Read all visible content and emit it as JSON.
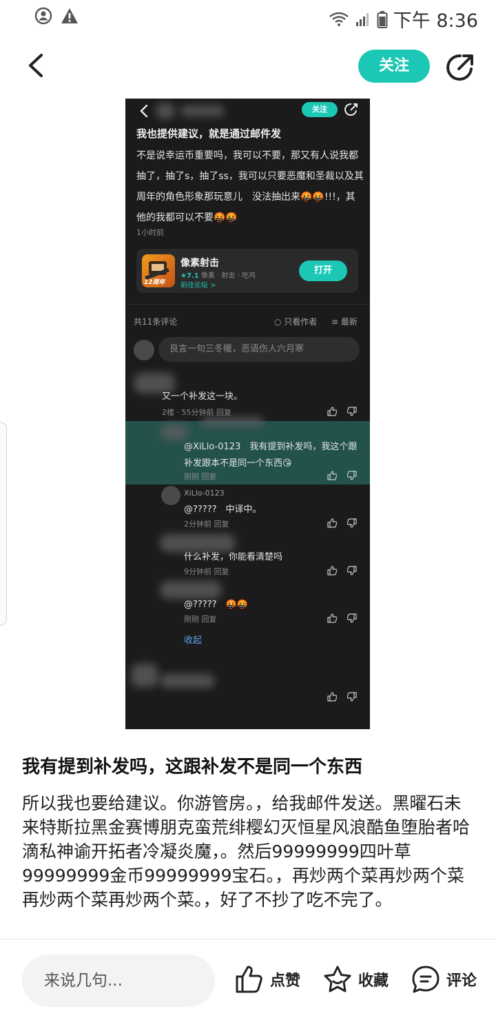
{
  "status_bar": {
    "time": "下午 8:36",
    "icons": [
      "account-circle-icon",
      "warning-icon",
      "wifi-icon",
      "signal-icon",
      "battery-icon"
    ]
  },
  "header": {
    "follow_label": "关注",
    "icons": [
      "back-arrow-icon",
      "share-icon"
    ]
  },
  "screenshot": {
    "follow_label": "关注",
    "title": "我也提供建议，就是通过邮件发",
    "body": "不是说幸运币重要吗，我可以不要，那又有人说我都抽了，抽了s，抽了ss，我可以只要恶魔和圣裁以及其周年的角色形象那玩意儿　没法抽出来🤬🤬!!!，其他的我都可以不要🤬🤬",
    "time": "1小时前",
    "game": {
      "name": "像素射击",
      "score": "★7.1",
      "tags": "像素 · 射击 · 吃鸡",
      "link": "前往论坛 >",
      "open_label": "打开",
      "badge": "12周年"
    },
    "comments_count": "共11条评论",
    "filter_author": "只看作者",
    "filter_latest": "最新",
    "input_placeholder": "良言一句三冬暖，恶语伤人六月寒",
    "comments": [
      {
        "text": "又一个补发这一块。",
        "meta": "2楼 · 55分钟前  回复"
      },
      {
        "text": "@XiLlo-0123　我有提到补发吗，我这个跟补发跟本不是同一个东西😘",
        "meta": "刚刚  回复"
      },
      {
        "name": "XiLlo-0123",
        "text": "@?????　中译中。",
        "meta": "2分钟前  回复"
      },
      {
        "text": "什么补发，你能看清楚吗",
        "meta": "9分钟前  回复"
      },
      {
        "text": "@?????　🤬🤬",
        "meta": "刚刚  回复"
      }
    ],
    "collapse_label": "收起"
  },
  "post": {
    "title": "我有提到补发吗，这跟补发不是同一个东西",
    "body": "所以我也要给建议。你游管房。，给我邮件发送。黑曜石未来特斯拉黑金赛博朋克蛮荒绯樱幻灭恒星风浪酷鱼堕胎者哈滴私神谕开拓者冷凝炎魔，。然后99999999四叶草99999999金币99999999宝石。，再炒两个菜再炒两个菜再炒两个菜再炒两个菜。，好了不抄了吃不完了。"
  },
  "bottom_bar": {
    "input_placeholder": "来说几句...",
    "like_label": "点赞",
    "collect_label": "收藏",
    "comment_label": "评论"
  },
  "colors": {
    "accent": "#1cc8b5",
    "screenshot_bg": "#1b1b1c",
    "highlight_row": "#23514c"
  }
}
